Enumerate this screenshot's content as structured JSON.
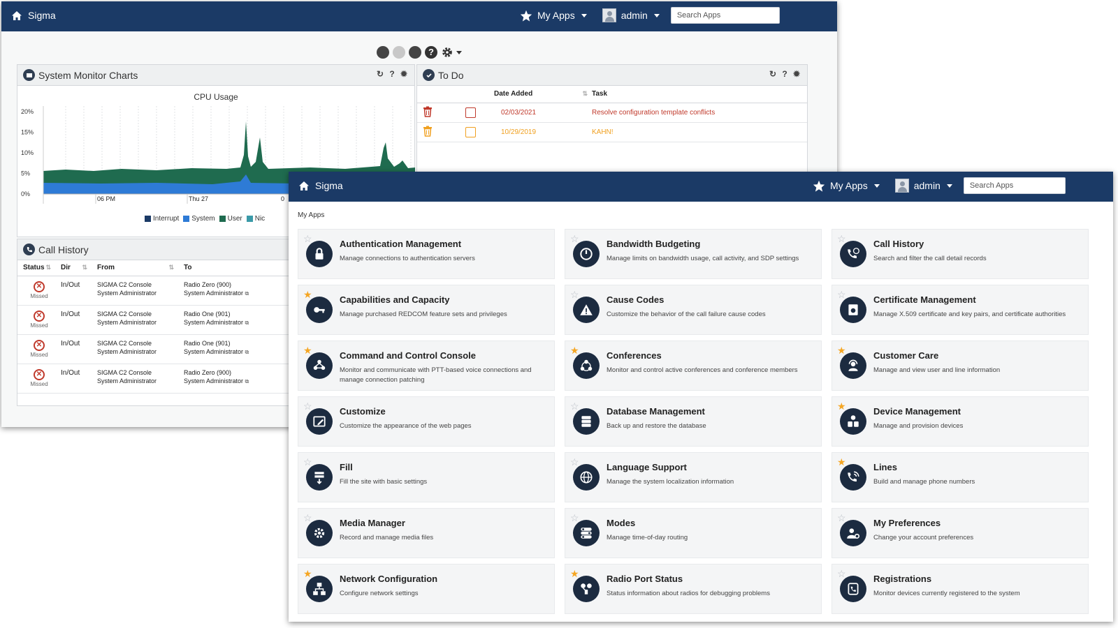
{
  "navbar": {
    "brand": "Sigma",
    "my_apps": "My Apps",
    "user": "admin",
    "search_placeholder": "Search Apps"
  },
  "back_window": {
    "system_monitor": {
      "title": "System Monitor Charts",
      "chart_title": "CPU Usage",
      "y_ticks": [
        "20%",
        "15%",
        "10%",
        "5%",
        "0%"
      ],
      "x_ticks": [
        "06 PM",
        "Thu 27",
        "0"
      ],
      "legend": [
        {
          "label": "Interrupt",
          "color": "#1b3a66"
        },
        {
          "label": "System",
          "color": "#2e7bd6"
        },
        {
          "label": "User",
          "color": "#1f6b4f"
        },
        {
          "label": "Nic",
          "color": "#3a9aa8"
        }
      ]
    },
    "todo": {
      "title": "To Do",
      "columns": [
        "Date Added",
        "Task"
      ],
      "rows": [
        {
          "date": "02/03/2021",
          "task": "Resolve configuration template conflicts",
          "color": "#c0392b"
        },
        {
          "date": "10/29/2019",
          "task": "KAHN!",
          "color": "#f0a020"
        }
      ]
    },
    "call_history": {
      "title": "Call History",
      "columns": [
        "Status",
        "Dir",
        "From",
        "To"
      ],
      "rows": [
        {
          "status": "Missed",
          "dir": "In/Out",
          "from1": "SIGMA C2 Console",
          "from2": "System Administrator",
          "to1": "Radio Zero (900)",
          "to2": "System Administrator"
        },
        {
          "status": "Missed",
          "dir": "In/Out",
          "from1": "SIGMA C2 Console",
          "from2": "System Administrator",
          "to1": "Radio One (901)",
          "to2": "System Administrator"
        },
        {
          "status": "Missed",
          "dir": "In/Out",
          "from1": "SIGMA C2 Console",
          "from2": "System Administrator",
          "to1": "Radio One (901)",
          "to2": "System Administrator"
        },
        {
          "status": "Missed",
          "dir": "In/Out",
          "from1": "SIGMA C2 Console",
          "from2": "System Administrator",
          "to1": "Radio Zero (900)",
          "to2": "System Administrator"
        }
      ]
    }
  },
  "front_window": {
    "section_label": "My Apps",
    "apps": [
      {
        "title": "Authentication Management",
        "desc": "Manage connections to authentication servers",
        "favorite": false,
        "icon": "lock-icon"
      },
      {
        "title": "Bandwidth Budgeting",
        "desc": "Manage limits on bandwidth usage, call activity, and SDP settings",
        "favorite": false,
        "icon": "gauge-icon"
      },
      {
        "title": "Call History",
        "desc": "Search and filter the call detail records",
        "favorite": false,
        "icon": "phone-clock-icon"
      },
      {
        "title": "Capabilities and Capacity",
        "desc": "Manage purchased REDCOM feature sets and privileges",
        "favorite": true,
        "icon": "key-icon"
      },
      {
        "title": "Cause Codes",
        "desc": "Customize the behavior of the call failure cause codes",
        "favorite": false,
        "icon": "warning-icon"
      },
      {
        "title": "Certificate Management",
        "desc": "Manage X.509 certificate and key pairs, and certificate authorities",
        "favorite": false,
        "icon": "certificate-icon"
      },
      {
        "title": "Command and Control Console",
        "desc": "Monitor and communicate with PTT-based voice connections and manage connection patching",
        "favorite": true,
        "icon": "radio-network-icon"
      },
      {
        "title": "Conferences",
        "desc": "Monitor and control active conferences and conference members",
        "favorite": true,
        "icon": "conference-icon"
      },
      {
        "title": "Customer Care",
        "desc": "Manage and view user and line information",
        "favorite": true,
        "icon": "customer-care-icon"
      },
      {
        "title": "Customize",
        "desc": "Customize the appearance of the web pages",
        "favorite": false,
        "icon": "edit-window-icon"
      },
      {
        "title": "Database Management",
        "desc": "Back up and restore the database",
        "favorite": false,
        "icon": "database-icon"
      },
      {
        "title": "Device Management",
        "desc": "Manage and provision devices",
        "favorite": true,
        "icon": "devices-icon"
      },
      {
        "title": "Fill",
        "desc": "Fill the site with basic settings",
        "favorite": false,
        "icon": "fill-icon"
      },
      {
        "title": "Language Support",
        "desc": "Manage the system localization information",
        "favorite": false,
        "icon": "globe-icon"
      },
      {
        "title": "Lines",
        "desc": "Build and manage phone numbers",
        "favorite": true,
        "icon": "phone-lines-icon"
      },
      {
        "title": "Media Manager",
        "desc": "Record and manage media files",
        "favorite": false,
        "icon": "media-gear-icon"
      },
      {
        "title": "Modes",
        "desc": "Manage time-of-day routing",
        "favorite": false,
        "icon": "toggles-icon"
      },
      {
        "title": "My Preferences",
        "desc": "Change your account preferences",
        "favorite": false,
        "icon": "user-gear-icon"
      },
      {
        "title": "Network Configuration",
        "desc": "Configure network settings",
        "favorite": true,
        "icon": "network-icon"
      },
      {
        "title": "Radio Port Status",
        "desc": "Status information about radios for debugging problems",
        "favorite": true,
        "icon": "radio-status-icon"
      },
      {
        "title": "Registrations",
        "desc": "Monitor devices currently registered to the system",
        "favorite": false,
        "icon": "registered-phone-icon"
      }
    ]
  },
  "colors": {
    "navbar": "#1b3a66",
    "star_favorite": "#f5a623",
    "star_empty": "#b9bec5",
    "icon_bg": "#1c2b40"
  }
}
